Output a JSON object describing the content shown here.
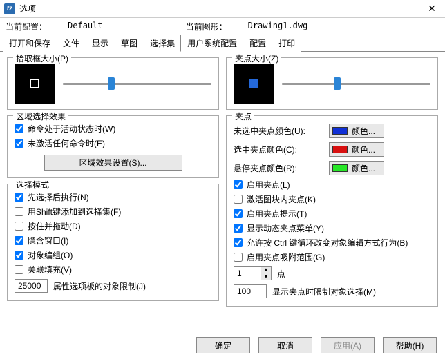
{
  "window": {
    "title": "选项"
  },
  "config_row": {
    "current_config_label": "当前配置：",
    "current_config_value": "Default",
    "current_drawing_label": "当前图形：",
    "current_drawing_value": "Drawing1.dwg"
  },
  "tabs": [
    "打开和保存",
    "文件",
    "显示",
    "草图",
    "选择集",
    "用户系统配置",
    "配置",
    "打印"
  ],
  "active_tab": "选择集",
  "pickbox": {
    "title": "拾取框大小(P)",
    "slider_pos_pct": 30
  },
  "gripsize": {
    "title": "夹点大小(Z)",
    "slider_pos_pct": 35
  },
  "region": {
    "title": "区域选择效果",
    "active_cmd": {
      "label": "命令处于活动状态时(W)",
      "checked": true
    },
    "no_cmd": {
      "label": "未激活任何命令时(E)",
      "checked": true
    },
    "settings_btn": "区域效果设置(S)..."
  },
  "select_mode": {
    "title": "选择模式",
    "items": [
      {
        "label": "先选择后执行(N)",
        "checked": true
      },
      {
        "label": "用Shift键添加到选择集(F)",
        "checked": false
      },
      {
        "label": "按住并拖动(D)",
        "checked": false
      },
      {
        "label": "隐含窗口(I)",
        "checked": true
      },
      {
        "label": "对象编组(O)",
        "checked": true
      },
      {
        "label": "关联填充(V)",
        "checked": false
      }
    ],
    "limit_value": "25000",
    "limit_label": "属性选项板的对象限制(J)"
  },
  "grips": {
    "title": "夹点",
    "unselected": {
      "label": "未选中夹点颜色(U):",
      "color": "#1030d6",
      "btn": "颜色..."
    },
    "selected": {
      "label": "选中夹点颜色(C):",
      "color": "#d81010",
      "btn": "颜色..."
    },
    "hover": {
      "label": "悬停夹点颜色(R):",
      "color": "#27e627",
      "btn": "颜色..."
    },
    "checks": [
      {
        "label": "启用夹点(L)",
        "checked": true
      },
      {
        "label": "激活图块内夹点(K)",
        "checked": false
      },
      {
        "label": "启用夹点提示(T)",
        "checked": true
      },
      {
        "label": "显示动态夹点菜单(Y)",
        "checked": true
      },
      {
        "label": "允许按 Ctrl 键循环改变对象编辑方式行为(B)",
        "checked": true
      },
      {
        "label": "启用夹点吸附范围(G)",
        "checked": false
      }
    ],
    "snap_value": "1",
    "snap_unit": "点",
    "limit_value": "100",
    "limit_label": "显示夹点时限制对象选择(M)"
  },
  "footer": {
    "ok": "确定",
    "cancel": "取消",
    "apply": "应用(A)",
    "help": "帮助(H)"
  }
}
